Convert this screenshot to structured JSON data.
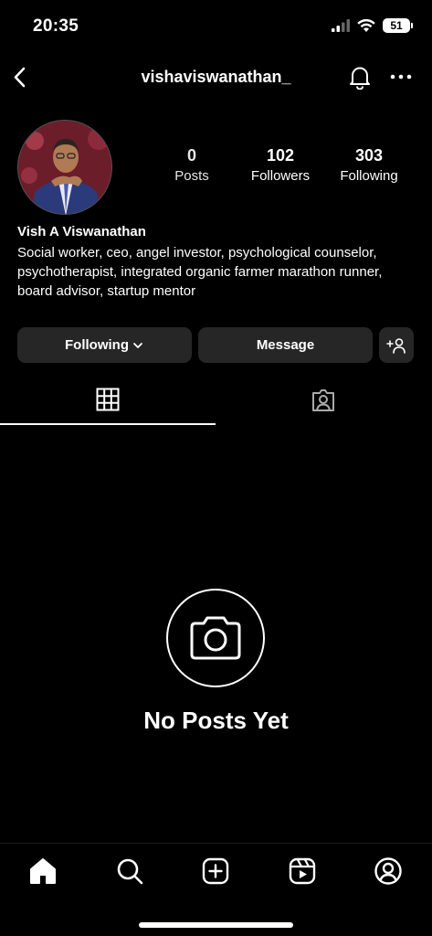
{
  "status_bar": {
    "time": "20:35",
    "battery": "51"
  },
  "header": {
    "username": "vishaviswanathan_"
  },
  "profile": {
    "name": "Vish A Viswanathan",
    "bio": "Social worker, ceo, angel investor, psychological counselor, psychotherapist, integrated organic farmer marathon runner, board advisor, startup mentor"
  },
  "stats": {
    "posts": {
      "value": "0",
      "label": "Posts"
    },
    "followers": {
      "value": "102",
      "label": "Followers"
    },
    "following": {
      "value": "303",
      "label": "Following"
    }
  },
  "actions": {
    "following_label": "Following",
    "message_label": "Message"
  },
  "empty_state": {
    "title": "No Posts Yet"
  },
  "icons": {
    "back": "chevron-left-icon",
    "bell": "bell-icon",
    "more": "more-horizontal-icon",
    "grid": "grid-icon",
    "tagged": "tagged-person-icon",
    "camera": "camera-icon",
    "home": "home-icon",
    "search": "search-icon",
    "create": "plus-square-icon",
    "reels": "reels-icon",
    "profile": "profile-icon"
  }
}
